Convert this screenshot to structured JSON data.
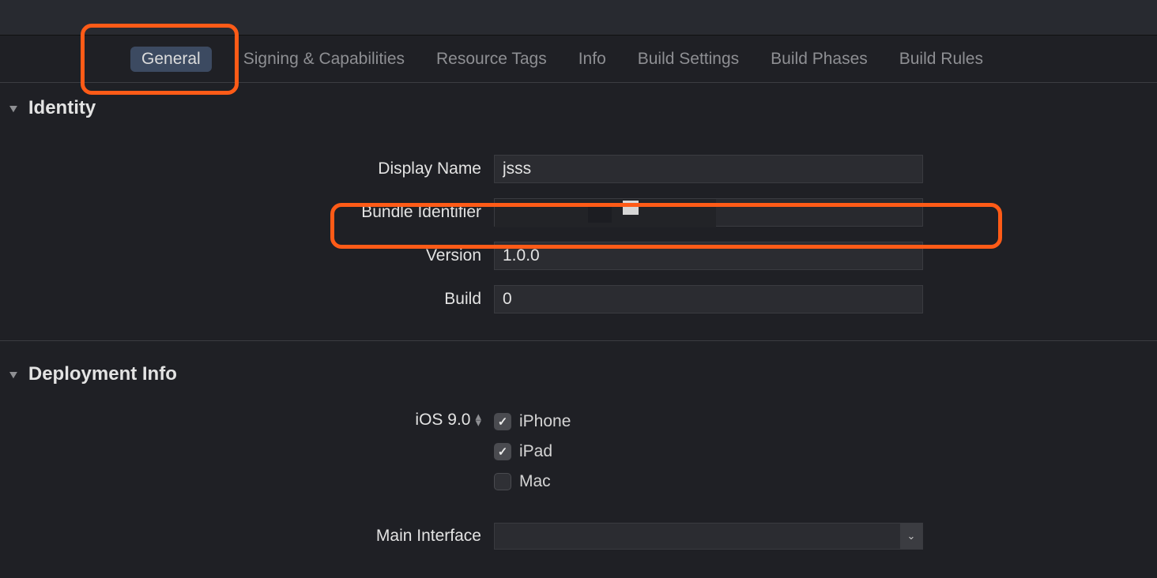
{
  "tabs": {
    "general": "General",
    "signing": "Signing & Capabilities",
    "resource": "Resource Tags",
    "info": "Info",
    "build_settings": "Build Settings",
    "build_phases": "Build Phases",
    "build_rules": "Build Rules"
  },
  "sections": {
    "identity": "Identity",
    "deployment": "Deployment Info"
  },
  "identity": {
    "display_name_label": "Display Name",
    "display_name_value": "jsss",
    "bundle_id_label": "Bundle Identifier",
    "bundle_id_value": "",
    "version_label": "Version",
    "version_value": "1.0.0",
    "build_label": "Build",
    "build_value": "0"
  },
  "deployment": {
    "target_label": "iOS 9.0",
    "device_iphone": "iPhone",
    "device_ipad": "iPad",
    "device_mac": "Mac",
    "main_interface_label": "Main Interface",
    "main_interface_value": ""
  }
}
